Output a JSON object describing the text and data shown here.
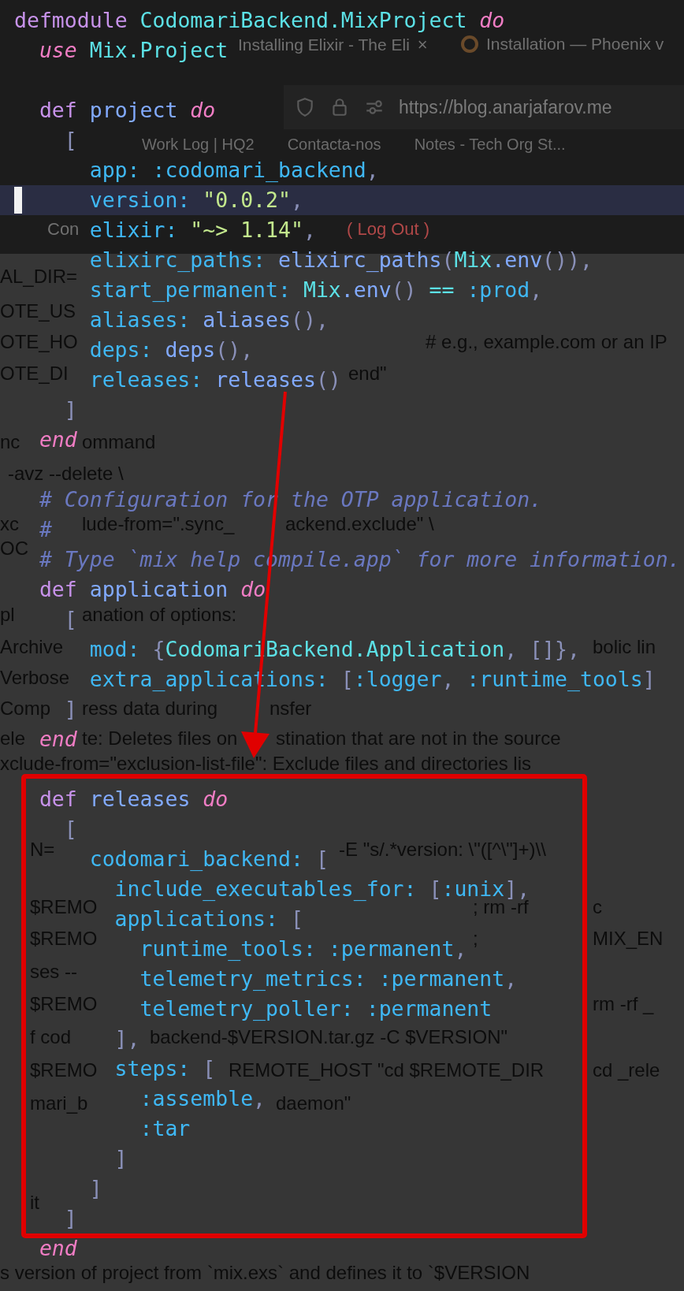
{
  "browser": {
    "tabs": [
      {
        "label": "Installing Elixir - The Eli",
        "close": "×"
      },
      {
        "label": "Installation — Phoenix v"
      }
    ],
    "address": "https://blog.anarjafarov.me",
    "bookmarks": [
      "Work Log | HQ2",
      "Contacta-nos",
      "Notes - Tech Org St..."
    ],
    "nav": [
      "Con",
      "( Log Out )"
    ]
  },
  "document_fragments": [
    "AL_DIR=",
    "OTE_US",
    "OTE_HO",
    "# e.g., example.com or an IP",
    "OTE_DI",
    "end\"",
    "nc",
    "ommand",
    "-avz --delete \\",
    "xc",
    "lude-from=\".sync_",
    "ackend.exclude\" \\",
    "OC",
    "pl",
    "anation of options:",
    "Archive",
    "bolic lin",
    "Verbose",
    "Comp",
    "ress data during",
    "nsfer",
    "ele",
    "te: Deletes files on",
    "stination that are not in the source",
    "xclude-from=\"exclusion-list-file\": Exclude files and directories lis",
    "N=",
    "-E \"s/.*version: \\\"([^\\\"]+)\\\\",
    "$REMO",
    "; rm -rf",
    "c",
    "$REMO",
    ";",
    "MIX_EN",
    "ses --",
    "$REMO",
    "rm -rf _",
    "f cod",
    "backend-$VERSION.tar.gz -C $VERSION\"",
    "$REMO",
    "REMOTE_HOST \"cd $REMOTE_DIR",
    "cd _rele",
    "mari_b",
    "daemon\"",
    "it",
    "s version of project from `mix.exs` and defines it to `$VERSION"
  ],
  "code_lines": [
    {
      "current": false,
      "tokens": [
        {
          "text": "defmodule ",
          "kind": "kw"
        },
        {
          "text": "CodomariBackend.MixProject ",
          "kind": "mod"
        },
        {
          "text": "do",
          "kind": "ctl"
        }
      ]
    },
    {
      "current": false,
      "tokens": [
        {
          "text": "  use ",
          "kind": "ctl"
        },
        {
          "text": "Mix.Project",
          "kind": "mod"
        }
      ]
    },
    {
      "current": false
    },
    {
      "current": false,
      "tokens": [
        {
          "text": "  def ",
          "kind": "kw"
        },
        {
          "text": "project ",
          "kind": "fn"
        },
        {
          "text": "do",
          "kind": "ctl"
        }
      ]
    },
    {
      "current": false,
      "tokens": [
        {
          "text": "    [",
          "kind": "punct"
        }
      ]
    },
    {
      "current": false,
      "tokens": [
        {
          "text": "      app: ",
          "kind": "key"
        },
        {
          "text": ":codomari_backend",
          "kind": "key"
        },
        {
          "text": ",",
          "kind": "punct"
        }
      ]
    },
    {
      "current": true,
      "tokens": [
        {
          "text": "      version: ",
          "kind": "key"
        },
        {
          "text": "\"0.0.2\"",
          "kind": "str"
        },
        {
          "text": ",",
          "kind": "punct"
        }
      ]
    },
    {
      "current": false,
      "tokens": [
        {
          "text": "      elixir: ",
          "kind": "key"
        },
        {
          "text": "\"~> 1.14\"",
          "kind": "str"
        },
        {
          "text": ",",
          "kind": "punct"
        }
      ]
    },
    {
      "current": false,
      "tokens": [
        {
          "text": "      elixirc_paths: ",
          "kind": "key"
        },
        {
          "text": "elixirc_paths",
          "kind": "fn"
        },
        {
          "text": "(",
          "kind": "punct"
        },
        {
          "text": "Mix",
          "kind": "mod"
        },
        {
          "text": ".env",
          "kind": "fn"
        },
        {
          "text": "())",
          "kind": "punct"
        },
        {
          "text": ",",
          "kind": "punct"
        }
      ]
    },
    {
      "current": false,
      "tokens": [
        {
          "text": "      start_permanent: ",
          "kind": "key"
        },
        {
          "text": "Mix",
          "kind": "mod"
        },
        {
          "text": ".env",
          "kind": "fn"
        },
        {
          "text": "()",
          "kind": "punct"
        },
        {
          "text": " == ",
          "kind": "op"
        },
        {
          "text": ":prod",
          "kind": "key"
        },
        {
          "text": ",",
          "kind": "punct"
        }
      ]
    },
    {
      "current": false,
      "tokens": [
        {
          "text": "      aliases: ",
          "kind": "key"
        },
        {
          "text": "aliases",
          "kind": "fn"
        },
        {
          "text": "()",
          "kind": "punct"
        },
        {
          "text": ",",
          "kind": "punct"
        }
      ]
    },
    {
      "current": false,
      "tokens": [
        {
          "text": "      deps: ",
          "kind": "key"
        },
        {
          "text": "deps",
          "kind": "fn"
        },
        {
          "text": "()",
          "kind": "punct"
        },
        {
          "text": ",",
          "kind": "punct"
        }
      ]
    },
    {
      "current": false,
      "tokens": [
        {
          "text": "      releases: ",
          "kind": "key"
        },
        {
          "text": "releases",
          "kind": "fn"
        },
        {
          "text": "()",
          "kind": "punct"
        }
      ]
    },
    {
      "current": false,
      "tokens": [
        {
          "text": "    ]",
          "kind": "punct"
        }
      ]
    },
    {
      "current": false,
      "tokens": [
        {
          "text": "  end",
          "kind": "ctl"
        }
      ]
    },
    {
      "current": false
    },
    {
      "current": false,
      "tokens": [
        {
          "text": "  # Configuration for the OTP application.",
          "kind": "cmt"
        }
      ]
    },
    {
      "current": false,
      "tokens": [
        {
          "text": "  #",
          "kind": "cmt"
        }
      ]
    },
    {
      "current": false,
      "tokens": [
        {
          "text": "  # Type `mix help compile.app` for more information.",
          "kind": "cmt"
        }
      ]
    },
    {
      "current": false,
      "tokens": [
        {
          "text": "  def ",
          "kind": "kw"
        },
        {
          "text": "application ",
          "kind": "fn"
        },
        {
          "text": "do",
          "kind": "ctl"
        }
      ]
    },
    {
      "current": false,
      "tokens": [
        {
          "text": "    [",
          "kind": "punct"
        }
      ]
    },
    {
      "current": false,
      "tokens": [
        {
          "text": "      mod: ",
          "kind": "key"
        },
        {
          "text": "{",
          "kind": "punct"
        },
        {
          "text": "CodomariBackend.Application",
          "kind": "mod"
        },
        {
          "text": ", ",
          "kind": "punct"
        },
        {
          "text": "[]",
          "kind": "punct"
        },
        {
          "text": "},",
          "kind": "punct"
        }
      ]
    },
    {
      "current": false,
      "tokens": [
        {
          "text": "      extra_applications: ",
          "kind": "key"
        },
        {
          "text": "[",
          "kind": "punct"
        },
        {
          "text": ":logger",
          "kind": "key"
        },
        {
          "text": ", ",
          "kind": "punct"
        },
        {
          "text": ":runtime_tools",
          "kind": "key"
        },
        {
          "text": "]",
          "kind": "punct"
        }
      ]
    },
    {
      "current": false,
      "tokens": [
        {
          "text": "    ]",
          "kind": "punct"
        }
      ]
    },
    {
      "current": false,
      "tokens": [
        {
          "text": "  end",
          "kind": "ctl"
        }
      ]
    },
    {
      "current": false
    },
    {
      "current": false,
      "tokens": [
        {
          "text": "  def ",
          "kind": "kw"
        },
        {
          "text": "releases ",
          "kind": "fn"
        },
        {
          "text": "do",
          "kind": "ctl"
        }
      ]
    },
    {
      "current": false,
      "tokens": [
        {
          "text": "    [",
          "kind": "punct"
        }
      ]
    },
    {
      "current": false,
      "tokens": [
        {
          "text": "      codomari_backend: ",
          "kind": "key"
        },
        {
          "text": "[",
          "kind": "punct"
        }
      ]
    },
    {
      "current": false,
      "tokens": [
        {
          "text": "        include_executables_for: ",
          "kind": "key"
        },
        {
          "text": "[",
          "kind": "punct"
        },
        {
          "text": ":unix",
          "kind": "key"
        },
        {
          "text": "],",
          "kind": "punct"
        }
      ]
    },
    {
      "current": false,
      "tokens": [
        {
          "text": "        applications: ",
          "kind": "key"
        },
        {
          "text": "[",
          "kind": "punct"
        }
      ]
    },
    {
      "current": false,
      "tokens": [
        {
          "text": "          runtime_tools: ",
          "kind": "key"
        },
        {
          "text": ":permanent",
          "kind": "key"
        },
        {
          "text": ",",
          "kind": "punct"
        }
      ]
    },
    {
      "current": false,
      "tokens": [
        {
          "text": "          telemetry_metrics: ",
          "kind": "key"
        },
        {
          "text": ":permanent",
          "kind": "key"
        },
        {
          "text": ",",
          "kind": "punct"
        }
      ]
    },
    {
      "current": false,
      "tokens": [
        {
          "text": "          telemetry_poller: ",
          "kind": "key"
        },
        {
          "text": ":permanent",
          "kind": "key"
        }
      ]
    },
    {
      "current": false,
      "tokens": [
        {
          "text": "        ]",
          "kind": "punct"
        },
        {
          "text": ",",
          "kind": "punct"
        }
      ]
    },
    {
      "current": false,
      "tokens": [
        {
          "text": "        steps: ",
          "kind": "key"
        },
        {
          "text": "[",
          "kind": "punct"
        }
      ]
    },
    {
      "current": false,
      "tokens": [
        {
          "text": "          :assemble",
          "kind": "key"
        },
        {
          "text": ",",
          "kind": "punct"
        }
      ]
    },
    {
      "current": false,
      "tokens": [
        {
          "text": "          :tar",
          "kind": "key"
        }
      ]
    },
    {
      "current": false,
      "tokens": [
        {
          "text": "        ]",
          "kind": "punct"
        }
      ]
    },
    {
      "current": false,
      "tokens": [
        {
          "text": "      ]",
          "kind": "punct"
        }
      ]
    },
    {
      "current": false,
      "tokens": [
        {
          "text": "    ]",
          "kind": "punct"
        }
      ]
    },
    {
      "current": false,
      "tokens": [
        {
          "text": "  end",
          "kind": "ctl"
        }
      ]
    }
  ]
}
